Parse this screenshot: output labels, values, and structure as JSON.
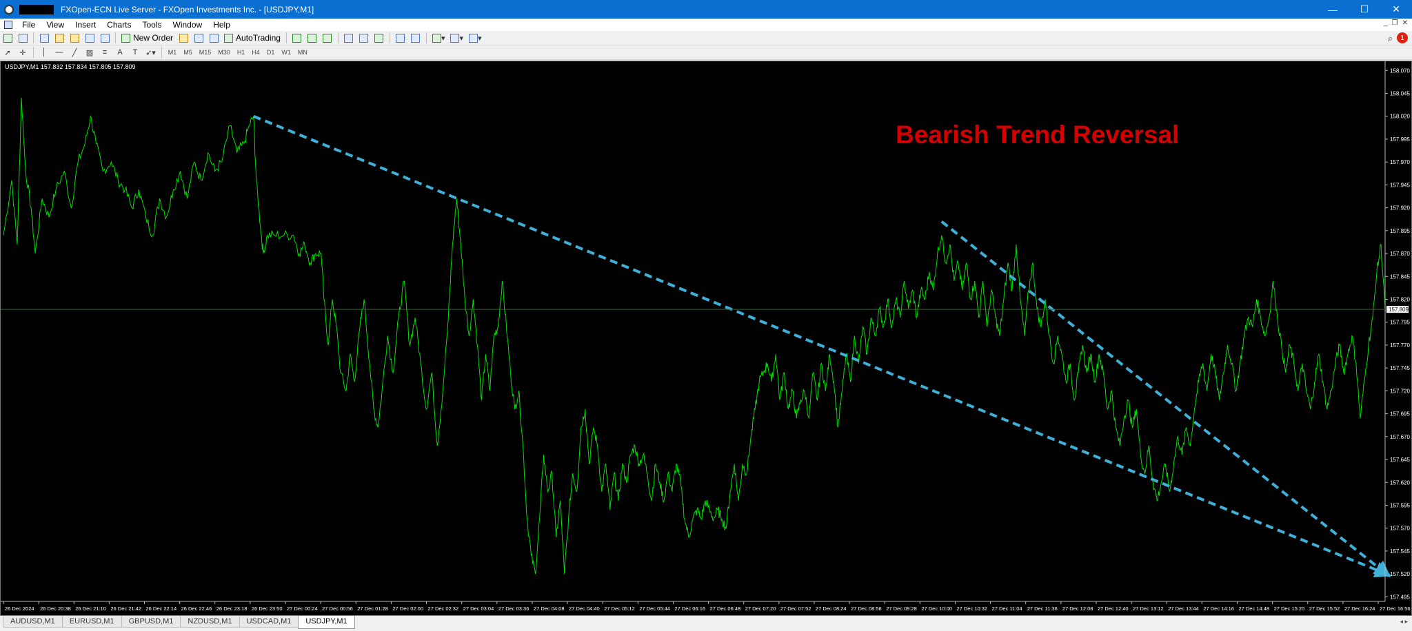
{
  "window": {
    "title": "FXOpen-ECN Live Server - FXOpen Investments Inc. - [USDJPY,M1]",
    "controls": {
      "minimize": "—",
      "maximize": "☐",
      "close": "✕"
    }
  },
  "menu": {
    "items": [
      "File",
      "View",
      "Insert",
      "Charts",
      "Tools",
      "Window",
      "Help"
    ]
  },
  "toolbar": {
    "new_order_label": "New Order",
    "autotrading_label": "AutoTrading",
    "timeframes": [
      "M1",
      "M5",
      "M15",
      "M30",
      "H1",
      "H4",
      "D1",
      "W1",
      "MN"
    ],
    "notification_count": "1"
  },
  "chart": {
    "info_line": "USDJPY,M1  157.832 157.834 157.805 157.809",
    "annotation": "Bearish Trend Reversal",
    "current_price_label": "157.809",
    "colors": {
      "background": "#000000",
      "line": "#00e000",
      "trendline": "#3fb0d8",
      "annotation": "#d40000",
      "grid": "#2e6b2e"
    }
  },
  "chart_data": {
    "type": "line",
    "series": [
      {
        "name": "USDJPY,M1",
        "values": []
      }
    ],
    "x_tick_labels": [
      "26 Dec 2024",
      "26 Dec 20:38",
      "26 Dec 21:10",
      "26 Dec 21:42",
      "26 Dec 22:14",
      "26 Dec 22:46",
      "26 Dec 23:18",
      "26 Dec 23:50",
      "27 Dec 00:24",
      "27 Dec 00:56",
      "27 Dec 01:28",
      "27 Dec 02:00",
      "27 Dec 02:32",
      "27 Dec 03:04",
      "27 Dec 03:36",
      "27 Dec 04:08",
      "27 Dec 04:40",
      "27 Dec 05:12",
      "27 Dec 05:44",
      "27 Dec 06:16",
      "27 Dec 06:48",
      "27 Dec 07:20",
      "27 Dec 07:52",
      "27 Dec 08:24",
      "27 Dec 08:56",
      "27 Dec 09:28",
      "27 Dec 10:00",
      "27 Dec 10:32",
      "27 Dec 11:04",
      "27 Dec 11:36",
      "27 Dec 12:08",
      "27 Dec 12:40",
      "27 Dec 13:12",
      "27 Dec 13:44",
      "27 Dec 14:16",
      "27 Dec 14:48",
      "27 Dec 15:20",
      "27 Dec 15:52",
      "27 Dec 16:24",
      "27 Dec 16:56"
    ],
    "y_tick_labels": [
      "158.070",
      "158.045",
      "158.020",
      "157.995",
      "157.970",
      "157.945",
      "157.920",
      "157.895",
      "157.870",
      "157.845",
      "157.820",
      "157.795",
      "157.770",
      "157.745",
      "157.720",
      "157.695",
      "157.670",
      "157.645",
      "157.620",
      "157.595",
      "157.570",
      "157.545",
      "157.520",
      "157.495"
    ],
    "ylim": [
      157.49,
      158.08
    ],
    "current_price": 157.809,
    "price_path": [
      [
        0,
        157.89
      ],
      [
        0.6,
        157.95
      ],
      [
        1.0,
        157.88
      ],
      [
        1.3,
        158.04
      ],
      [
        1.6,
        157.96
      ],
      [
        2.0,
        157.92
      ],
      [
        2.3,
        157.87
      ],
      [
        2.8,
        157.93
      ],
      [
        3.3,
        157.91
      ],
      [
        3.8,
        157.94
      ],
      [
        4.4,
        157.96
      ],
      [
        4.9,
        157.92
      ],
      [
        5.4,
        157.97
      ],
      [
        5.9,
        157.99
      ],
      [
        6.3,
        158.02
      ],
      [
        6.7,
        157.99
      ],
      [
        7.2,
        157.96
      ],
      [
        7.8,
        157.97
      ],
      [
        8.3,
        157.95
      ],
      [
        8.8,
        157.94
      ],
      [
        9.3,
        157.92
      ],
      [
        9.8,
        157.94
      ],
      [
        10.3,
        157.91
      ],
      [
        10.8,
        157.89
      ],
      [
        11.3,
        157.93
      ],
      [
        11.8,
        157.91
      ],
      [
        12.3,
        157.94
      ],
      [
        12.8,
        157.96
      ],
      [
        13.3,
        157.93
      ],
      [
        13.8,
        157.97
      ],
      [
        14.3,
        157.95
      ],
      [
        14.8,
        157.98
      ],
      [
        15.3,
        157.96
      ],
      [
        15.8,
        157.97
      ],
      [
        16.4,
        158.01
      ],
      [
        16.9,
        157.98
      ],
      [
        17.4,
        157.99
      ],
      [
        17.8,
        158.01
      ],
      [
        18.1,
        158.02
      ],
      [
        18.3,
        157.95
      ],
      [
        18.6,
        157.9
      ],
      [
        18.8,
        157.87
      ],
      [
        19.1,
        157.89
      ],
      [
        19.6,
        157.89
      ],
      [
        20.3,
        157.89
      ],
      [
        21.0,
        157.89
      ],
      [
        21.4,
        157.87
      ],
      [
        21.8,
        157.88
      ],
      [
        22.2,
        157.86
      ],
      [
        22.6,
        157.87
      ],
      [
        23.0,
        157.87
      ],
      [
        23.2,
        157.82
      ],
      [
        23.5,
        157.77
      ],
      [
        23.8,
        157.82
      ],
      [
        24.1,
        157.79
      ],
      [
        24.4,
        157.74
      ],
      [
        24.8,
        157.72
      ],
      [
        25.1,
        157.76
      ],
      [
        25.4,
        157.73
      ],
      [
        25.8,
        157.79
      ],
      [
        26.1,
        157.82
      ],
      [
        26.5,
        157.75
      ],
      [
        26.8,
        157.7
      ],
      [
        27.1,
        157.68
      ],
      [
        27.4,
        157.72
      ],
      [
        27.8,
        157.78
      ],
      [
        28.2,
        157.74
      ],
      [
        28.6,
        157.8
      ],
      [
        29.0,
        157.84
      ],
      [
        29.4,
        157.77
      ],
      [
        29.8,
        157.8
      ],
      [
        30.2,
        157.75
      ],
      [
        30.6,
        157.7
      ],
      [
        31.0,
        157.74
      ],
      [
        31.4,
        157.66
      ],
      [
        31.8,
        157.72
      ],
      [
        32.2,
        157.8
      ],
      [
        32.5,
        157.88
      ],
      [
        32.8,
        157.93
      ],
      [
        33.1,
        157.88
      ],
      [
        33.4,
        157.82
      ],
      [
        33.7,
        157.78
      ],
      [
        34.0,
        157.82
      ],
      [
        34.3,
        157.77
      ],
      [
        34.6,
        157.71
      ],
      [
        34.9,
        157.76
      ],
      [
        35.2,
        157.72
      ],
      [
        35.5,
        157.78
      ],
      [
        35.8,
        157.79
      ],
      [
        36.1,
        157.84
      ],
      [
        36.4,
        157.79
      ],
      [
        36.7,
        157.74
      ],
      [
        37.0,
        157.7
      ],
      [
        37.3,
        157.72
      ],
      [
        37.6,
        157.66
      ],
      [
        37.9,
        157.58
      ],
      [
        38.2,
        157.54
      ],
      [
        38.5,
        157.52
      ],
      [
        38.8,
        157.58
      ],
      [
        39.1,
        157.65
      ],
      [
        39.4,
        157.61
      ],
      [
        39.7,
        157.63
      ],
      [
        40.0,
        157.56
      ],
      [
        40.3,
        157.6
      ],
      [
        40.6,
        157.52
      ],
      [
        40.9,
        157.58
      ],
      [
        41.2,
        157.63
      ],
      [
        41.5,
        157.61
      ],
      [
        41.8,
        157.68
      ],
      [
        42.1,
        157.7
      ],
      [
        42.4,
        157.64
      ],
      [
        42.7,
        157.68
      ],
      [
        43.0,
        157.66
      ],
      [
        43.3,
        157.61
      ],
      [
        43.6,
        157.64
      ],
      [
        43.9,
        157.59
      ],
      [
        44.2,
        157.63
      ],
      [
        44.5,
        157.6
      ],
      [
        44.8,
        157.64
      ],
      [
        45.1,
        157.62
      ],
      [
        45.4,
        157.65
      ],
      [
        45.7,
        157.66
      ],
      [
        46.0,
        157.64
      ],
      [
        46.3,
        157.65
      ],
      [
        46.6,
        157.63
      ],
      [
        46.9,
        157.6
      ],
      [
        47.2,
        157.64
      ],
      [
        47.5,
        157.62
      ],
      [
        47.8,
        157.6
      ],
      [
        48.1,
        157.63
      ],
      [
        48.4,
        157.61
      ],
      [
        48.7,
        157.64
      ],
      [
        49.0,
        157.62
      ],
      [
        49.3,
        157.58
      ],
      [
        49.6,
        157.56
      ],
      [
        49.9,
        157.58
      ],
      [
        50.2,
        157.59
      ],
      [
        50.5,
        157.58
      ],
      [
        50.8,
        157.6
      ],
      [
        51.1,
        157.59
      ],
      [
        51.4,
        157.58
      ],
      [
        51.7,
        157.59
      ],
      [
        52.0,
        157.58
      ],
      [
        52.3,
        157.57
      ],
      [
        52.6,
        157.61
      ],
      [
        52.9,
        157.64
      ],
      [
        53.2,
        157.6
      ],
      [
        53.5,
        157.64
      ],
      [
        53.8,
        157.63
      ],
      [
        54.1,
        157.67
      ],
      [
        54.4,
        157.7
      ],
      [
        54.7,
        157.73
      ],
      [
        55.0,
        157.74
      ],
      [
        55.3,
        157.75
      ],
      [
        55.6,
        157.73
      ],
      [
        55.9,
        157.76
      ],
      [
        56.2,
        157.71
      ],
      [
        56.5,
        157.74
      ],
      [
        56.8,
        157.7
      ],
      [
        57.1,
        157.72
      ],
      [
        57.4,
        157.69
      ],
      [
        57.7,
        157.71
      ],
      [
        58.0,
        157.72
      ],
      [
        58.3,
        157.69
      ],
      [
        58.6,
        157.74
      ],
      [
        58.9,
        157.71
      ],
      [
        59.2,
        157.75
      ],
      [
        59.5,
        157.72
      ],
      [
        59.8,
        157.76
      ],
      [
        60.1,
        157.73
      ],
      [
        60.4,
        157.68
      ],
      [
        60.7,
        157.72
      ],
      [
        61.0,
        157.76
      ],
      [
        61.3,
        157.73
      ],
      [
        61.6,
        157.78
      ],
      [
        61.9,
        157.75
      ],
      [
        62.2,
        157.79
      ],
      [
        62.5,
        157.76
      ],
      [
        62.8,
        157.8
      ],
      [
        63.1,
        157.78
      ],
      [
        63.4,
        157.81
      ],
      [
        63.7,
        157.79
      ],
      [
        64.0,
        157.82
      ],
      [
        64.3,
        157.79
      ],
      [
        64.6,
        157.82
      ],
      [
        64.9,
        157.8
      ],
      [
        65.2,
        157.84
      ],
      [
        65.5,
        157.81
      ],
      [
        65.8,
        157.83
      ],
      [
        66.1,
        157.8
      ],
      [
        66.4,
        157.83
      ],
      [
        66.7,
        157.82
      ],
      [
        67.0,
        157.85
      ],
      [
        67.3,
        157.83
      ],
      [
        67.6,
        157.87
      ],
      [
        67.9,
        157.89
      ],
      [
        68.2,
        157.86
      ],
      [
        68.5,
        157.88
      ],
      [
        68.8,
        157.84
      ],
      [
        69.1,
        157.86
      ],
      [
        69.4,
        157.83
      ],
      [
        69.7,
        157.86
      ],
      [
        70.0,
        157.82
      ],
      [
        70.3,
        157.84
      ],
      [
        70.6,
        157.8
      ],
      [
        70.9,
        157.84
      ],
      [
        71.2,
        157.79
      ],
      [
        71.5,
        157.83
      ],
      [
        71.8,
        157.8
      ],
      [
        72.1,
        157.78
      ],
      [
        72.4,
        157.82
      ],
      [
        72.7,
        157.86
      ],
      [
        73.0,
        157.83
      ],
      [
        73.3,
        157.88
      ],
      [
        73.6,
        157.82
      ],
      [
        73.9,
        157.78
      ],
      [
        74.2,
        157.83
      ],
      [
        74.5,
        157.86
      ],
      [
        74.8,
        157.81
      ],
      [
        75.1,
        157.79
      ],
      [
        75.4,
        157.82
      ],
      [
        75.7,
        157.78
      ],
      [
        76.0,
        157.75
      ],
      [
        76.3,
        157.78
      ],
      [
        76.6,
        157.76
      ],
      [
        76.9,
        157.73
      ],
      [
        77.2,
        157.75
      ],
      [
        77.5,
        157.71
      ],
      [
        77.8,
        157.74
      ],
      [
        78.1,
        157.77
      ],
      [
        78.4,
        157.74
      ],
      [
        78.7,
        157.76
      ],
      [
        79.0,
        157.73
      ],
      [
        79.3,
        157.76
      ],
      [
        79.6,
        157.74
      ],
      [
        79.9,
        157.7
      ],
      [
        80.2,
        157.72
      ],
      [
        80.5,
        157.68
      ],
      [
        80.8,
        157.66
      ],
      [
        81.1,
        157.69
      ],
      [
        81.4,
        157.71
      ],
      [
        81.7,
        157.68
      ],
      [
        82.0,
        157.7
      ],
      [
        82.3,
        157.65
      ],
      [
        82.6,
        157.63
      ],
      [
        82.9,
        157.66
      ],
      [
        83.2,
        157.62
      ],
      [
        83.5,
        157.6
      ],
      [
        83.8,
        157.62
      ],
      [
        84.1,
        157.64
      ],
      [
        84.4,
        157.61
      ],
      [
        84.7,
        157.64
      ],
      [
        85.0,
        157.67
      ],
      [
        85.3,
        157.65
      ],
      [
        85.6,
        157.68
      ],
      [
        85.9,
        157.66
      ],
      [
        86.2,
        157.7
      ],
      [
        86.5,
        157.73
      ],
      [
        86.8,
        157.75
      ],
      [
        87.1,
        157.72
      ],
      [
        87.4,
        157.76
      ],
      [
        87.7,
        157.74
      ],
      [
        88.0,
        157.71
      ],
      [
        88.3,
        157.74
      ],
      [
        88.6,
        157.77
      ],
      [
        88.9,
        157.75
      ],
      [
        89.2,
        157.72
      ],
      [
        89.5,
        157.75
      ],
      [
        89.8,
        157.78
      ],
      [
        90.1,
        157.8
      ],
      [
        90.4,
        157.79
      ],
      [
        90.7,
        157.82
      ],
      [
        91.0,
        157.8
      ],
      [
        91.3,
        157.78
      ],
      [
        91.6,
        157.8
      ],
      [
        91.9,
        157.84
      ],
      [
        92.2,
        157.8
      ],
      [
        92.5,
        157.77
      ],
      [
        92.8,
        157.74
      ],
      [
        93.1,
        157.77
      ],
      [
        93.4,
        157.75
      ],
      [
        93.7,
        157.72
      ],
      [
        94.0,
        157.75
      ],
      [
        94.3,
        157.72
      ],
      [
        94.6,
        157.7
      ],
      [
        94.9,
        157.73
      ],
      [
        95.2,
        157.76
      ],
      [
        95.5,
        157.73
      ],
      [
        95.8,
        157.7
      ],
      [
        96.1,
        157.72
      ],
      [
        96.4,
        157.75
      ],
      [
        96.7,
        157.77
      ],
      [
        97.0,
        157.74
      ],
      [
        97.3,
        157.76
      ],
      [
        97.6,
        157.78
      ],
      [
        97.9,
        157.75
      ],
      [
        98.2,
        157.69
      ],
      [
        98.5,
        157.73
      ],
      [
        98.8,
        157.77
      ],
      [
        99.1,
        157.8
      ],
      [
        99.4,
        157.85
      ],
      [
        99.7,
        157.88
      ],
      [
        100,
        157.81
      ]
    ],
    "trendlines": [
      {
        "from": [
          18.1,
          158.02
        ],
        "to": [
          100,
          157.52
        ],
        "style": "dashed",
        "arrow": true
      },
      {
        "from": [
          67.9,
          157.905
        ],
        "to": [
          100,
          157.52
        ],
        "style": "dashed",
        "arrow": true
      }
    ]
  },
  "tabs": [
    {
      "label": "AUDUSD,M1",
      "active": false
    },
    {
      "label": "EURUSD,M1",
      "active": false
    },
    {
      "label": "GBPUSD,M1",
      "active": false
    },
    {
      "label": "NZDUSD,M1",
      "active": false
    },
    {
      "label": "USDCAD,M1",
      "active": false
    },
    {
      "label": "USDJPY,M1",
      "active": true
    }
  ]
}
